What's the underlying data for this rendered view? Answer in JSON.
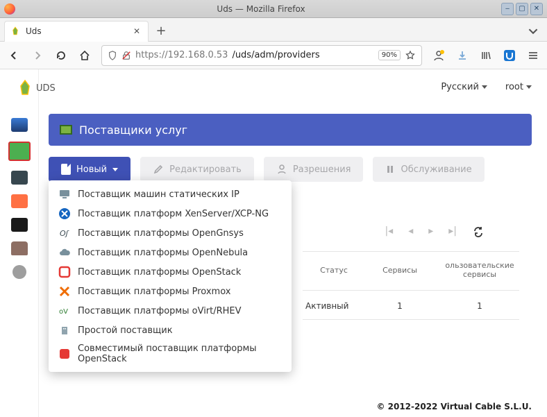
{
  "window": {
    "title": "Uds — Mozilla Firefox"
  },
  "tab": {
    "title": "Uds"
  },
  "url": {
    "host": "https://192.168.0.53",
    "path": "/uds/adm/providers",
    "zoom": "90%"
  },
  "brand": {
    "name": "UDS"
  },
  "top_right": {
    "language": "Русский",
    "user": "root"
  },
  "panel": {
    "title": "Поставщики услуг"
  },
  "toolbar": {
    "new_label": "Новый",
    "edit_label": "Редактировать",
    "perm_label": "Разрешения",
    "maint_label": "Обслуживание"
  },
  "dropdown": {
    "items": [
      "Поставщик машин статических IP",
      "Поставщик платформ XenServer/XCP-NG",
      "Поставщик платформы OpenGnsys",
      "Поставщик платформы OpenNebula",
      "Поставщик платформы OpenStack",
      "Поставщик платформы Proxmox",
      "Поставщик платформы oVirt/RHEV",
      "Простой поставщик",
      "Совместимый поставщик платформы OpenStack"
    ]
  },
  "table": {
    "headers": {
      "status": "Статус",
      "services": "Сервисы",
      "user_services": "ользовательские сервисы"
    },
    "row": {
      "status": "Активный",
      "services": "1",
      "user_services": "1"
    }
  },
  "footer": {
    "copyright": "© 2012-2022 Virtual Cable S.L.U."
  }
}
